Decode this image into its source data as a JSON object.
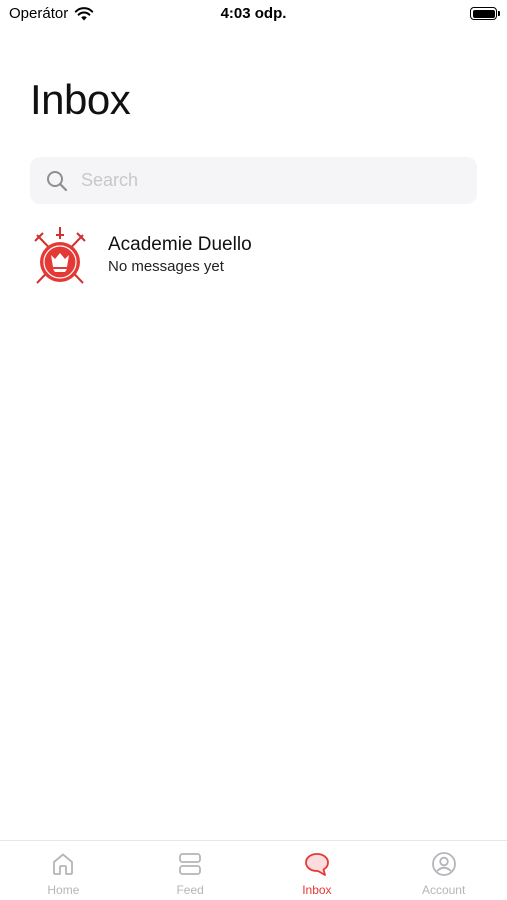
{
  "status_bar": {
    "carrier": "Operátor",
    "time": "4:03 odp."
  },
  "title": "Inbox",
  "search": {
    "placeholder": "Search",
    "value": ""
  },
  "conversations": [
    {
      "name": "Academie Duello",
      "preview": "No messages yet",
      "avatar_icon": "academie-duello-crest-icon"
    }
  ],
  "tabs": [
    {
      "label": "Home",
      "icon": "home-icon",
      "active": false
    },
    {
      "label": "Feed",
      "icon": "feed-icon",
      "active": false
    },
    {
      "label": "Inbox",
      "icon": "chat-bubble-icon",
      "active": true
    },
    {
      "label": "Account",
      "icon": "account-icon",
      "active": false
    }
  ],
  "colors": {
    "accent": "#e53935",
    "inactive": "#b5b5ba",
    "search_bg": "#f5f5f7"
  }
}
